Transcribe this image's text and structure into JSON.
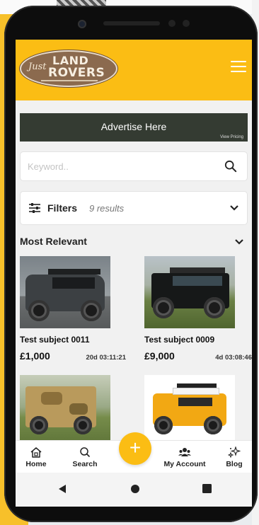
{
  "header": {
    "logo_script": "Just",
    "logo_line1": "LAND",
    "logo_line2": "ROVERS"
  },
  "ad": {
    "title": "Advertise Here",
    "sub": "View Pricing"
  },
  "search": {
    "placeholder": "Keyword.."
  },
  "filters": {
    "label": "Filters",
    "count": "9 results"
  },
  "sort": {
    "label": "Most Relevant"
  },
  "listings": [
    {
      "title": "Test subject 0011",
      "price": "£1,000",
      "time_left": "20d 03:11:21"
    },
    {
      "title": "Test subject 0009",
      "price": "£9,000",
      "time_left": "4d 03:08:46"
    }
  ],
  "nav": {
    "home": "Home",
    "search": "Search",
    "add": "+",
    "account": "My Account",
    "blog": "Blog"
  },
  "colors": {
    "brand": "#fbbd14",
    "ad_bg": "#343b32"
  },
  "icons": [
    "hamburger-icon",
    "search-icon",
    "sliders-icon",
    "chevron-down-icon",
    "home-icon",
    "users-icon",
    "sparkles-icon",
    "back-icon",
    "home-circle-icon",
    "recents-square-icon"
  ]
}
